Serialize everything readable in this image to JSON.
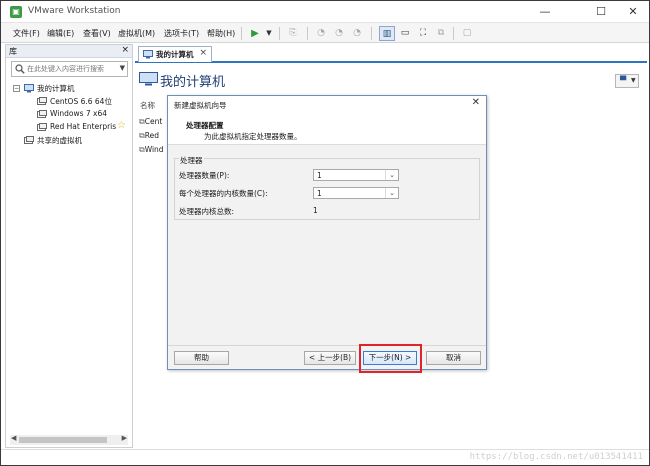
{
  "window": {
    "title": "VMware Workstation",
    "controls": [
      "—",
      "☐",
      "✕"
    ]
  },
  "menubar": {
    "items": [
      "文件(F)",
      "编辑(E)",
      "查看(V)",
      "虚拟机(M)",
      "选项卡(T)",
      "帮助(H)"
    ]
  },
  "library": {
    "title": "库",
    "close": "×",
    "search_placeholder": "在此处键入内容进行搜索",
    "tree": {
      "root": "我的计算机",
      "vms": [
        "CentOS 6.6 64位",
        "Windows 7 x64",
        "Red Hat Enterpris"
      ],
      "shared": "共享的虚拟机"
    }
  },
  "tab": {
    "label": "我的计算机",
    "close": "×"
  },
  "content": {
    "title": "我的计算机",
    "column_header": "名称",
    "vm_rows": [
      "Cent",
      "Red",
      "Wind"
    ]
  },
  "dialog": {
    "title": "新建虚拟机向导",
    "close": "✕",
    "header_title": "处理器配置",
    "header_subtitle": "为此虚拟机指定处理器数量。",
    "group_title": "处理器",
    "fields": [
      {
        "label": "处理器数量(P):",
        "value": "1"
      },
      {
        "label": "每个处理器的内核数量(C):",
        "value": "1"
      },
      {
        "label": "处理器内核总数:",
        "value": "1"
      }
    ],
    "buttons": {
      "help": "帮助",
      "back": "< 上一步(B)",
      "next": "下一步(N) >",
      "cancel": "取消"
    }
  },
  "watermark": "https://blog.csdn.net/u013541411",
  "colors": {
    "accent": "#2e74c1",
    "highlight": "#e0242b",
    "title_blue": "#1f3e77"
  }
}
